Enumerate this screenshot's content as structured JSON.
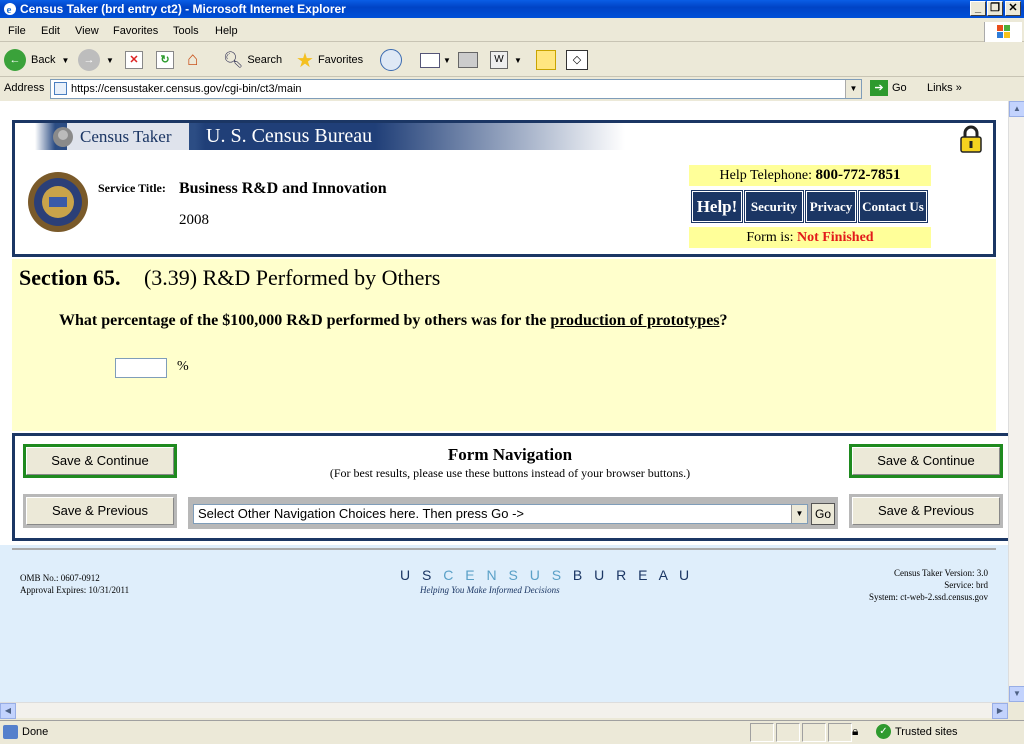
{
  "window": {
    "title": "Census Taker (brd entry ct2) - Microsoft Internet Explorer",
    "minimize": "_",
    "restore": "❐",
    "close": "✕"
  },
  "menu": [
    "File",
    "Edit",
    "View",
    "Favorites",
    "Tools",
    "Help"
  ],
  "toolbar": {
    "back": "Back",
    "search": "Search",
    "favorites": "Favorites"
  },
  "address": {
    "label": "Address",
    "url": "https://censustaker.census.gov/cgi-bin/ct3/main",
    "go": "Go",
    "links": "Links"
  },
  "header": {
    "census_taker": "Census Taker",
    "bureau": "U. S. Census Bureau",
    "service_label": "Service Title:",
    "service_title": "Business R&D and Innovation",
    "year": "2008",
    "help_tel_label": "Help Telephone:",
    "help_tel_number": "800-772-7851",
    "help": "Help!",
    "security": "Security",
    "privacy": "Privacy",
    "contact": "Contact Us",
    "form_is_label": "Form is:",
    "form_status": "Not Finished"
  },
  "section": {
    "number": "Section 65.",
    "title": "(3.39) R&D Performed by Others",
    "question_prefix": "What percentage of the $100,000 R&D performed by others was for the",
    "question_link": "production of prototypes",
    "question_suffix": "?",
    "input_value": "",
    "unit": "%"
  },
  "navigation": {
    "title": "Form Navigation",
    "subtitle": "(For best results, please use these buttons instead of your browser buttons.)",
    "save_continue": "Save & Continue",
    "save_previous": "Save & Previous",
    "select_text": "Select Other Navigation Choices here. Then press Go ->",
    "go": "Go"
  },
  "footer": {
    "omb": "OMB No.: 0607-0912",
    "approval": "Approval Expires: 10/31/2011",
    "logo_pre": "U S ",
    "logo_mid": "C E N S U S",
    "logo_post": " B U R E A U",
    "tagline": "Helping You Make Informed Decisions",
    "version": "Census Taker Version: 3.0",
    "service": "Service: brd",
    "system": "System: ct-web-2.ssd.census.gov"
  },
  "status": {
    "text": "Done",
    "zone": "Trusted sites"
  },
  "colors": {
    "navy": "#1b3664",
    "section_bg": "#ffffcc",
    "highlight": "#ffff99",
    "not_finished": "#e21a1a",
    "footer_bg": "#dfeefb"
  }
}
